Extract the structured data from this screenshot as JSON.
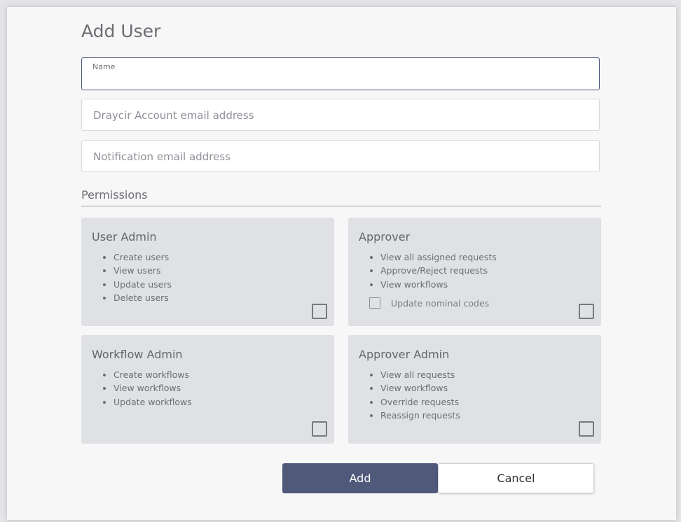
{
  "dialog": {
    "title": "Add User"
  },
  "fields": {
    "name": {
      "label": "Name",
      "value": ""
    },
    "account_email": {
      "placeholder": "Draycir Account email address"
    },
    "notification_email": {
      "placeholder": "Notification email address"
    }
  },
  "permissions": {
    "heading": "Permissions",
    "cards": [
      {
        "title": "User Admin",
        "items": [
          "Create users",
          "View users",
          "Update users",
          "Delete users"
        ],
        "checked": false
      },
      {
        "title": "Approver",
        "items": [
          "View all assigned requests",
          "Approve/Reject requests",
          "View workflows"
        ],
        "sub_option": {
          "label": "Update nominal codes",
          "checked": false
        },
        "checked": false
      },
      {
        "title": "Workflow Admin",
        "items": [
          "Create workflows",
          "View workflows",
          "Update workflows"
        ],
        "checked": false
      },
      {
        "title": "Approver Admin",
        "items": [
          "View all requests",
          "View workflows",
          "Override requests",
          "Reassign requests"
        ],
        "checked": false
      }
    ]
  },
  "actions": {
    "add_label": "Add",
    "cancel_label": "Cancel"
  },
  "colors": {
    "primary": "#50597a",
    "card_bg": "#e0e1e4",
    "dialog_bg": "#f7f7f8"
  }
}
